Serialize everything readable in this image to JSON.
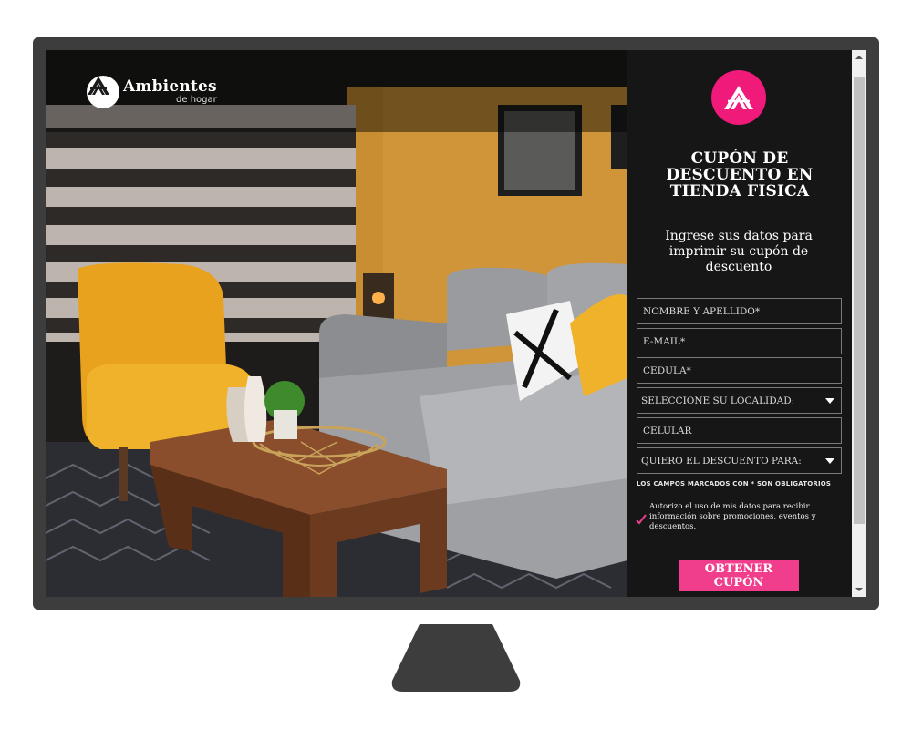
{
  "brand": {
    "name": "Ambientes",
    "tagline": "de hogar"
  },
  "panel": {
    "title": "CUPÓN DE DESCUENTO EN TIENDA FISICA",
    "subtitle": "Ingrese sus datos para imprimir su cupón de descuento",
    "fields": {
      "name_placeholder": "NOMBRE Y APELLIDO*",
      "email_placeholder": "E-MAIL*",
      "id_placeholder": "CEDULA*",
      "locality_select": "SELECCIONE SU LOCALIDAD:",
      "phone_placeholder": "CELULAR",
      "discount_select": "QUIERO EL DESCUENTO PARA:"
    },
    "required_note": "LOS CAMPOS MARCADOS CON * SON OBLIGATORIOS",
    "consent_text": "Autorizo el uso de mis datos para recibir información sobre promociones, eventos y descuentos.",
    "consent_checked": true,
    "submit_label": "OBTENER CUPÓN"
  },
  "colors": {
    "accent": "#ef1a7a",
    "button": "#f03e8c",
    "panel_bg": "#161616",
    "monitor": "#3d3d3d"
  },
  "icons": [
    "brand-logo-icon",
    "chevron-down-icon",
    "checkmark-icon",
    "scroll-up-icon",
    "scroll-down-icon"
  ]
}
